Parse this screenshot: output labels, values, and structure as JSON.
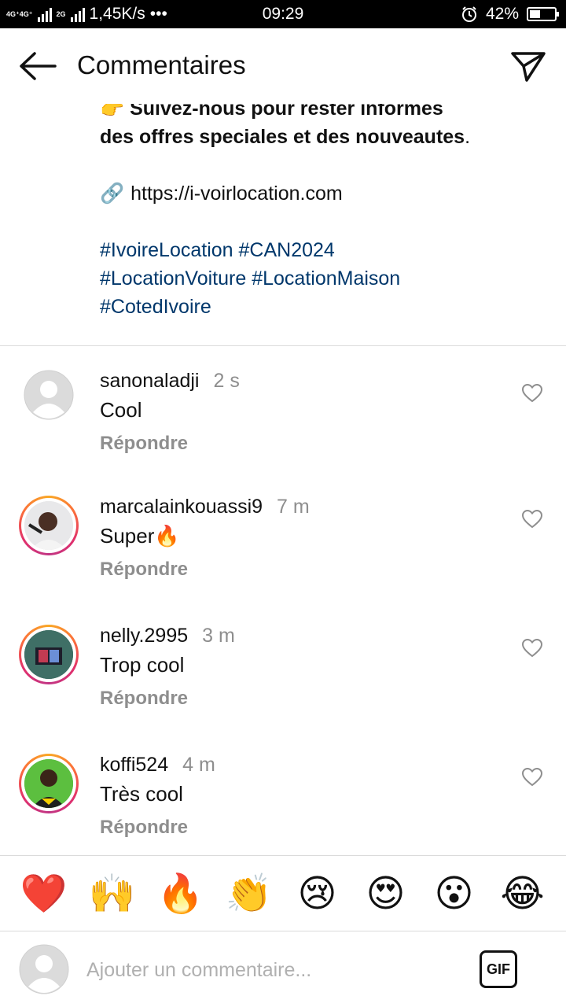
{
  "status_bar": {
    "network_top": "4G⁺4G⁺",
    "network_mid": "2G",
    "speed": "1,45K/s",
    "dots": "•••",
    "time": "09:29",
    "battery_text": "42%",
    "battery_level": 0.42
  },
  "header": {
    "title": "Commentaires"
  },
  "caption": {
    "line1": "👉 Suivez-nous pour rester informés",
    "line2_bold": "des offres speciales et des nouveautes",
    "line2_end": ".",
    "link_icon": "🔗",
    "link": "https://i-voirlocation.com",
    "hashtags": [
      "#IvoireLocation #CAN2024",
      "#LocationVoiture #LocationMaison",
      "#CotedIvoire"
    ]
  },
  "comments": [
    {
      "user": "sanonaladji",
      "time": "2 s",
      "text": "Cool",
      "reply": "Répondre",
      "avatar": "default-avatar"
    },
    {
      "user": "marcalainkouassi9",
      "time": "7 m",
      "text": "Super🔥",
      "reply": "Répondre",
      "avatar": "story-ring-avatar"
    },
    {
      "user": "nelly.2995",
      "time": "3 m",
      "text": "Trop cool",
      "reply": "Répondre",
      "avatar": "story-ring-avatar"
    },
    {
      "user": "koffi524",
      "time": "4 m",
      "text": "Très cool",
      "reply": "Répondre",
      "avatar": "story-ring-avatar"
    }
  ],
  "emoji_bar": [
    "❤️",
    "🙌",
    "🔥",
    "👏",
    "😢",
    "😍",
    "😮",
    "😂"
  ],
  "input": {
    "placeholder": "Ajouter un commentaire...",
    "gif_label": "GIF"
  },
  "colors": {
    "hashtag": "#00376b",
    "muted": "#8e8e8e",
    "divider": "#dbdbdb"
  }
}
